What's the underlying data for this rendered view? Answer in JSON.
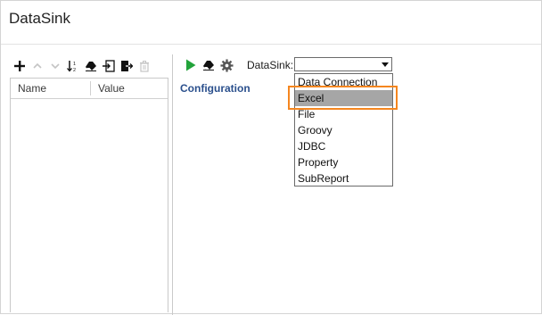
{
  "window": {
    "title": "DataSink"
  },
  "left_toolbar": {
    "icons": [
      "plus-icon",
      "arrow-up-icon",
      "arrow-down-icon",
      "sort-icon",
      "eraser-icon",
      "import-icon",
      "export-icon",
      "trash-icon"
    ]
  },
  "properties_table": {
    "columns": [
      "Name",
      "Value"
    ],
    "rows": []
  },
  "right_toolbar": {
    "icons": [
      "play-icon",
      "eraser-icon",
      "gear-icon"
    ],
    "play_color": "#22a33a"
  },
  "datasink": {
    "label": "DataSink:",
    "selected_value": "",
    "options": [
      "Data Connection",
      "Excel",
      "File",
      "Groovy",
      "JDBC",
      "Property",
      "SubReport"
    ],
    "highlighted_option": "Excel"
  },
  "configuration": {
    "heading": "Configuration"
  },
  "colors": {
    "highlight_border": "#f5861f",
    "selected_option_bg": "#a6a6a6",
    "configuration_heading": "#2a4f8c"
  }
}
